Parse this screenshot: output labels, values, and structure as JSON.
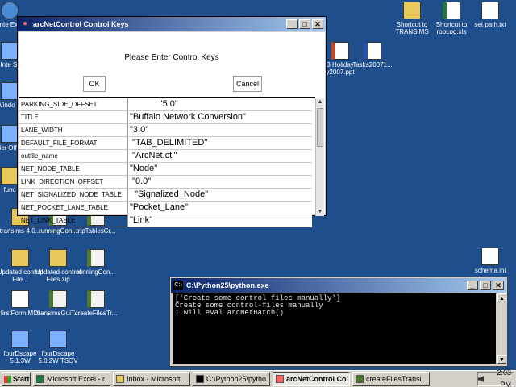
{
  "desktop": {
    "icons": [
      {
        "label": "Inte Exp",
        "icon": "internet-explorer-icon"
      },
      {
        "label": "Inte St",
        "icon": "app-icon"
      },
      {
        "label": "Windo Pl",
        "icon": "app-icon"
      },
      {
        "label": "Micr Office",
        "icon": "app-icon"
      },
      {
        "label": "func",
        "icon": "folder-icon"
      },
      {
        "label": "transims-4.0...",
        "icon": "folder-icon"
      },
      {
        "label": "runningCon...",
        "icon": "python-file-icon"
      },
      {
        "label": "tripTablesCr...",
        "icon": "python-file-icon"
      },
      {
        "label": "Updated control File...",
        "icon": "folder-icon"
      },
      {
        "label": "Updated control Files.zip",
        "icon": "zip-icon"
      },
      {
        "label": "runningCon...",
        "icon": "python-file-icon"
      },
      {
        "label": "firstForm.MDI",
        "icon": "document-icon"
      },
      {
        "label": "transimsGuiT...",
        "icon": "python-file-icon"
      },
      {
        "label": "createFilesTr...",
        "icon": "python-file-icon"
      },
      {
        "label": "fourDscape 5.1.3W",
        "icon": "app-icon"
      },
      {
        "label": "fourDscape 5.0.2W TSOV",
        "icon": "app-icon"
      },
      {
        "label": "Shortcut to TRANSIMS",
        "icon": "folder-icon"
      },
      {
        "label": "Shortcut to robLog.xls",
        "icon": "excel-file-icon"
      },
      {
        "label": "set path.txt",
        "icon": "text-file-icon"
      },
      {
        "label": "3 Holiday y2007.ppt",
        "icon": "powerpoint-file-icon"
      },
      {
        "label": "Tasks20071...",
        "icon": "word-file-icon"
      },
      {
        "label": "schema.ini",
        "icon": "settings-file-icon"
      }
    ]
  },
  "dialog": {
    "title": "arcNetControl Control Keys",
    "prompt": "Please Enter Control Keys",
    "ok_label": "OK",
    "cancel_label": "Cancel",
    "rows": [
      {
        "key": "PARKING_SIDE_OFFSET",
        "value": "            \"5.0\""
      },
      {
        "key": "TITLE",
        "value": "\"Buffalo Network Conversion\""
      },
      {
        "key": "LANE_WIDTH",
        "value": "\"3.0\""
      },
      {
        "key": "DEFAULT_FILE_FORMAT",
        "value": " \"TAB_DELIMITED\""
      },
      {
        "key": "outfile_name",
        "value": " \"ArcNet.ctl\""
      },
      {
        "key": "NET_NODE_TABLE",
        "value": "\"Node\""
      },
      {
        "key": "LINK_DIRECTION_OFFSET",
        "value": " \"0.0\""
      },
      {
        "key": "NET_SIGNALIZED_NODE_TABLE",
        "value": "  \"Signalized_Node\""
      },
      {
        "key": "NET_POCKET_LANE_TABLE",
        "value": "\"Pocket_Lane\""
      },
      {
        "key": "NET_LINK_TABLE",
        "value": "\"Link\""
      }
    ]
  },
  "console": {
    "title": "C:\\Python25\\python.exe",
    "lines": [
      "['Create some control-files manually']",
      "Create some control-files manually",
      "I will eval arcNetBatch()"
    ]
  },
  "taskbar": {
    "start_label": "Start",
    "tasks": [
      {
        "label": "Microsoft Excel - r...",
        "active": false
      },
      {
        "label": "Inbox - Microsoft ...",
        "active": false
      },
      {
        "label": "C:\\Python25\\pytho...",
        "active": false
      },
      {
        "label": "arcNetControl Co...",
        "active": true
      },
      {
        "label": "createFilesTransi...",
        "active": false
      }
    ],
    "clock": "2:03 PM"
  },
  "colors": {
    "desktop": "#1f4e8c",
    "title_active": "#0a246a",
    "console_bg": "#000000"
  }
}
